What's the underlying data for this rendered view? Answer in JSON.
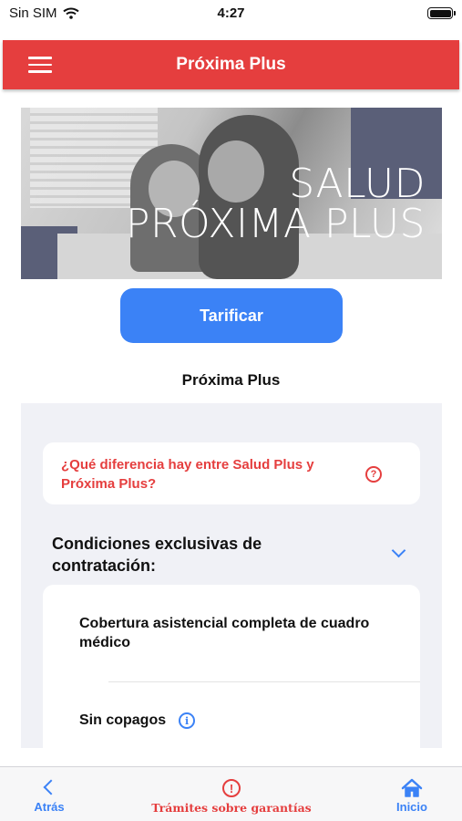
{
  "status_bar": {
    "carrier": "Sin SIM",
    "time": "4:27"
  },
  "header": {
    "title": "Próxima Plus",
    "menu_icon": "hamburger-menu-icon"
  },
  "hero": {
    "line1": "SALUD",
    "line2": "PRÓXIMA PLUS"
  },
  "actions": {
    "tarificar_label": "Tarificar"
  },
  "section": {
    "title": "Próxima Plus"
  },
  "faq": {
    "question": "¿Qué diferencia hay entre Salud Plus y Próxima Plus?",
    "icon": "question-circle-icon"
  },
  "conditions": {
    "title": "Condiciones exclusivas de contratación:",
    "expanded": true,
    "items": [
      {
        "label": "Cobertura asistencial completa de cuadro médico"
      },
      {
        "label": "Sin copagos",
        "icon": "info-icon"
      }
    ]
  },
  "tab_bar": {
    "back_label": "Atrás",
    "tramites_label": "Trámites sobre garantías",
    "inicio_label": "Inicio"
  },
  "colors": {
    "brand_red": "#e53e3e",
    "accent_blue": "#3b82f6",
    "panel_bg": "#f0f1f6"
  }
}
